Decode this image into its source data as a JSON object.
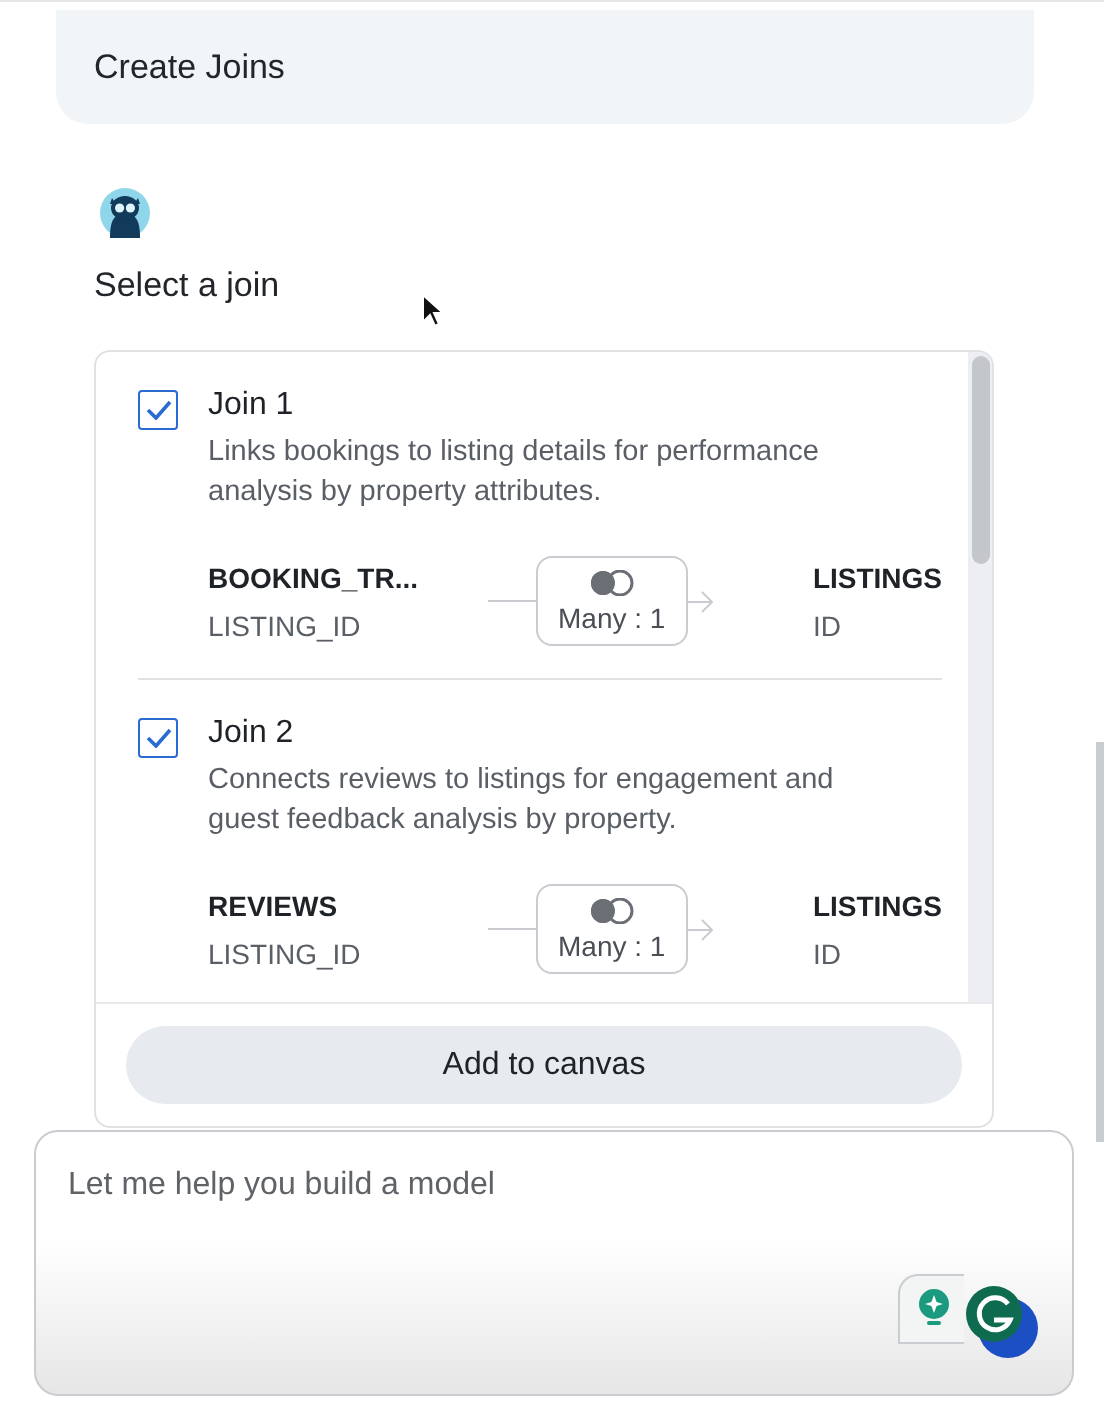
{
  "header": {
    "title": "Create Joins"
  },
  "prompt": "Select a join",
  "joins": [
    {
      "title": "Join 1",
      "checked": true,
      "description": "Links bookings to listing details for performance analysis by property attributes.",
      "left": {
        "table": "BOOKING_TR...",
        "column": "LISTING_ID"
      },
      "cardinality": "Many : 1",
      "right": {
        "table": "LISTINGS",
        "column": "ID"
      }
    },
    {
      "title": "Join 2",
      "checked": true,
      "description": "Connects reviews to listings for engagement and guest feedback analysis by property.",
      "left": {
        "table": "REVIEWS",
        "column": "LISTING_ID"
      },
      "cardinality": "Many : 1",
      "right": {
        "table": "LISTINGS",
        "column": "ID"
      }
    }
  ],
  "add_button": "Add to canvas",
  "input": {
    "placeholder": "Let me help you build a model"
  }
}
